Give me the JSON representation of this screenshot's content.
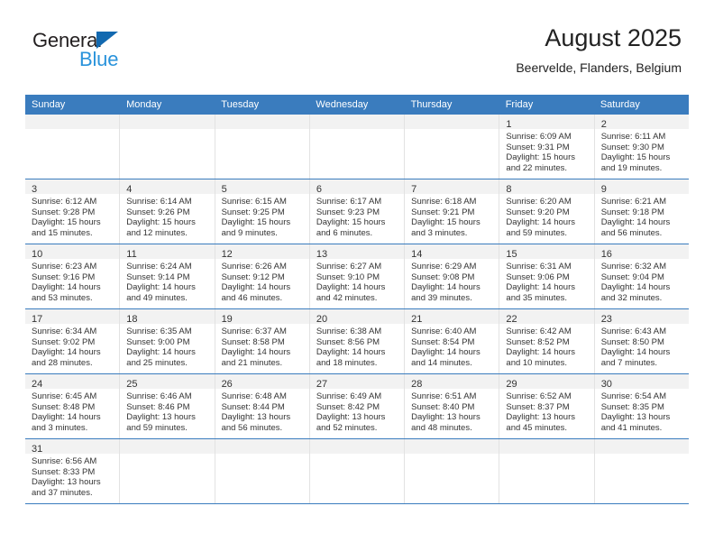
{
  "brand": {
    "word_one": "General",
    "word_two": "Blue",
    "color_dark": "#231f20",
    "color_blue": "#2a93db",
    "triangle_color": "#1269b0"
  },
  "header": {
    "title": "August 2025",
    "subtitle": "Beervelde, Flanders, Belgium"
  },
  "theme": {
    "header_bar": "#3a7cbe",
    "daynum_band": "#f2f2f2",
    "column_divider": "#e2e2e2",
    "text": "#333333"
  },
  "weekdays": [
    "Sunday",
    "Monday",
    "Tuesday",
    "Wednesday",
    "Thursday",
    "Friday",
    "Saturday"
  ],
  "weeks": [
    [
      {
        "day": "",
        "lines": []
      },
      {
        "day": "",
        "lines": []
      },
      {
        "day": "",
        "lines": []
      },
      {
        "day": "",
        "lines": []
      },
      {
        "day": "",
        "lines": []
      },
      {
        "day": "1",
        "lines": [
          "Sunrise: 6:09 AM",
          "Sunset: 9:31 PM",
          "Daylight: 15 hours",
          "and 22 minutes."
        ]
      },
      {
        "day": "2",
        "lines": [
          "Sunrise: 6:11 AM",
          "Sunset: 9:30 PM",
          "Daylight: 15 hours",
          "and 19 minutes."
        ]
      }
    ],
    [
      {
        "day": "3",
        "lines": [
          "Sunrise: 6:12 AM",
          "Sunset: 9:28 PM",
          "Daylight: 15 hours",
          "and 15 minutes."
        ]
      },
      {
        "day": "4",
        "lines": [
          "Sunrise: 6:14 AM",
          "Sunset: 9:26 PM",
          "Daylight: 15 hours",
          "and 12 minutes."
        ]
      },
      {
        "day": "5",
        "lines": [
          "Sunrise: 6:15 AM",
          "Sunset: 9:25 PM",
          "Daylight: 15 hours",
          "and 9 minutes."
        ]
      },
      {
        "day": "6",
        "lines": [
          "Sunrise: 6:17 AM",
          "Sunset: 9:23 PM",
          "Daylight: 15 hours",
          "and 6 minutes."
        ]
      },
      {
        "day": "7",
        "lines": [
          "Sunrise: 6:18 AM",
          "Sunset: 9:21 PM",
          "Daylight: 15 hours",
          "and 3 minutes."
        ]
      },
      {
        "day": "8",
        "lines": [
          "Sunrise: 6:20 AM",
          "Sunset: 9:20 PM",
          "Daylight: 14 hours",
          "and 59 minutes."
        ]
      },
      {
        "day": "9",
        "lines": [
          "Sunrise: 6:21 AM",
          "Sunset: 9:18 PM",
          "Daylight: 14 hours",
          "and 56 minutes."
        ]
      }
    ],
    [
      {
        "day": "10",
        "lines": [
          "Sunrise: 6:23 AM",
          "Sunset: 9:16 PM",
          "Daylight: 14 hours",
          "and 53 minutes."
        ]
      },
      {
        "day": "11",
        "lines": [
          "Sunrise: 6:24 AM",
          "Sunset: 9:14 PM",
          "Daylight: 14 hours",
          "and 49 minutes."
        ]
      },
      {
        "day": "12",
        "lines": [
          "Sunrise: 6:26 AM",
          "Sunset: 9:12 PM",
          "Daylight: 14 hours",
          "and 46 minutes."
        ]
      },
      {
        "day": "13",
        "lines": [
          "Sunrise: 6:27 AM",
          "Sunset: 9:10 PM",
          "Daylight: 14 hours",
          "and 42 minutes."
        ]
      },
      {
        "day": "14",
        "lines": [
          "Sunrise: 6:29 AM",
          "Sunset: 9:08 PM",
          "Daylight: 14 hours",
          "and 39 minutes."
        ]
      },
      {
        "day": "15",
        "lines": [
          "Sunrise: 6:31 AM",
          "Sunset: 9:06 PM",
          "Daylight: 14 hours",
          "and 35 minutes."
        ]
      },
      {
        "day": "16",
        "lines": [
          "Sunrise: 6:32 AM",
          "Sunset: 9:04 PM",
          "Daylight: 14 hours",
          "and 32 minutes."
        ]
      }
    ],
    [
      {
        "day": "17",
        "lines": [
          "Sunrise: 6:34 AM",
          "Sunset: 9:02 PM",
          "Daylight: 14 hours",
          "and 28 minutes."
        ]
      },
      {
        "day": "18",
        "lines": [
          "Sunrise: 6:35 AM",
          "Sunset: 9:00 PM",
          "Daylight: 14 hours",
          "and 25 minutes."
        ]
      },
      {
        "day": "19",
        "lines": [
          "Sunrise: 6:37 AM",
          "Sunset: 8:58 PM",
          "Daylight: 14 hours",
          "and 21 minutes."
        ]
      },
      {
        "day": "20",
        "lines": [
          "Sunrise: 6:38 AM",
          "Sunset: 8:56 PM",
          "Daylight: 14 hours",
          "and 18 minutes."
        ]
      },
      {
        "day": "21",
        "lines": [
          "Sunrise: 6:40 AM",
          "Sunset: 8:54 PM",
          "Daylight: 14 hours",
          "and 14 minutes."
        ]
      },
      {
        "day": "22",
        "lines": [
          "Sunrise: 6:42 AM",
          "Sunset: 8:52 PM",
          "Daylight: 14 hours",
          "and 10 minutes."
        ]
      },
      {
        "day": "23",
        "lines": [
          "Sunrise: 6:43 AM",
          "Sunset: 8:50 PM",
          "Daylight: 14 hours",
          "and 7 minutes."
        ]
      }
    ],
    [
      {
        "day": "24",
        "lines": [
          "Sunrise: 6:45 AM",
          "Sunset: 8:48 PM",
          "Daylight: 14 hours",
          "and 3 minutes."
        ]
      },
      {
        "day": "25",
        "lines": [
          "Sunrise: 6:46 AM",
          "Sunset: 8:46 PM",
          "Daylight: 13 hours",
          "and 59 minutes."
        ]
      },
      {
        "day": "26",
        "lines": [
          "Sunrise: 6:48 AM",
          "Sunset: 8:44 PM",
          "Daylight: 13 hours",
          "and 56 minutes."
        ]
      },
      {
        "day": "27",
        "lines": [
          "Sunrise: 6:49 AM",
          "Sunset: 8:42 PM",
          "Daylight: 13 hours",
          "and 52 minutes."
        ]
      },
      {
        "day": "28",
        "lines": [
          "Sunrise: 6:51 AM",
          "Sunset: 8:40 PM",
          "Daylight: 13 hours",
          "and 48 minutes."
        ]
      },
      {
        "day": "29",
        "lines": [
          "Sunrise: 6:52 AM",
          "Sunset: 8:37 PM",
          "Daylight: 13 hours",
          "and 45 minutes."
        ]
      },
      {
        "day": "30",
        "lines": [
          "Sunrise: 6:54 AM",
          "Sunset: 8:35 PM",
          "Daylight: 13 hours",
          "and 41 minutes."
        ]
      }
    ],
    [
      {
        "day": "31",
        "lines": [
          "Sunrise: 6:56 AM",
          "Sunset: 8:33 PM",
          "Daylight: 13 hours",
          "and 37 minutes."
        ]
      },
      {
        "day": "",
        "lines": []
      },
      {
        "day": "",
        "lines": []
      },
      {
        "day": "",
        "lines": []
      },
      {
        "day": "",
        "lines": []
      },
      {
        "day": "",
        "lines": []
      },
      {
        "day": "",
        "lines": []
      }
    ]
  ]
}
